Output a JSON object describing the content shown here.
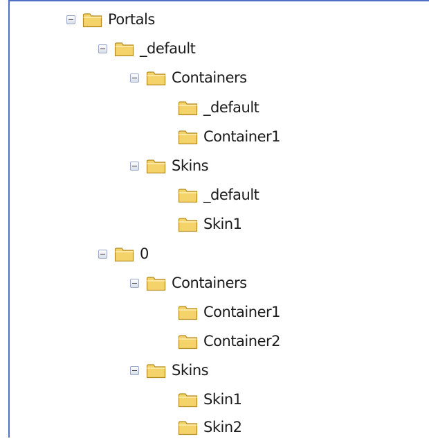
{
  "tree": {
    "portals": "Portals",
    "default": "_default",
    "default_containers": "Containers",
    "default_containers_default": "_default",
    "default_containers_container1": "Container1",
    "default_skins": "Skins",
    "default_skins_default": "_default",
    "default_skins_skin1": "Skin1",
    "zero": "0",
    "zero_containers": "Containers",
    "zero_containers_container1": "Container1",
    "zero_containers_container2": "Container2",
    "zero_skins": "Skins",
    "zero_skins_skin1": "Skin1",
    "zero_skins_skin2": "Skin2"
  },
  "icons": {
    "expander": "collapse-minus-icon",
    "folder": "folder-icon"
  },
  "colors": {
    "frame_border": "#4f6fc7",
    "folder_fill": "#f5d36b",
    "folder_stroke": "#b48a1d"
  }
}
